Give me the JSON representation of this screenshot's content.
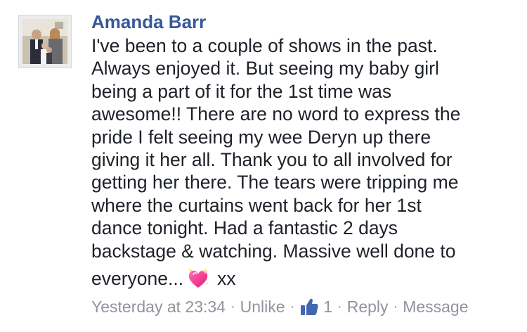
{
  "comment": {
    "author": "Amanda Barr",
    "text_lines": [
      "I've been to a couple of shows in the past.",
      "Always enjoyed it. But seeing my baby girl",
      "being a part of it for the 1st time was",
      "awesome!! There are no word to express the",
      "pride I felt seeing my wee Deryn up there",
      "giving it her all. Thank you to all involved for",
      "getting her there. The tears were tripping me",
      "where the curtains went back for her 1st",
      "dance tonight. Had a fantastic 2 days",
      "backstage & watching. Massive well done to"
    ],
    "last_line_start": "everyone...",
    "emoji_icon": "sparkling-heart-icon",
    "last_line_end": "xx",
    "timestamp": "Yesterday at 23:34",
    "unlike_label": "Unlike",
    "like_icon": "thumbs-up-icon",
    "like_count": "1",
    "reply_label": "Reply",
    "message_label": "Message",
    "separator": "·"
  },
  "colors": {
    "author": "#365899",
    "text": "#1d2129",
    "meta": "#90949c",
    "like_blue": "#4267b2",
    "heart_pink": "#ff2d8a"
  }
}
